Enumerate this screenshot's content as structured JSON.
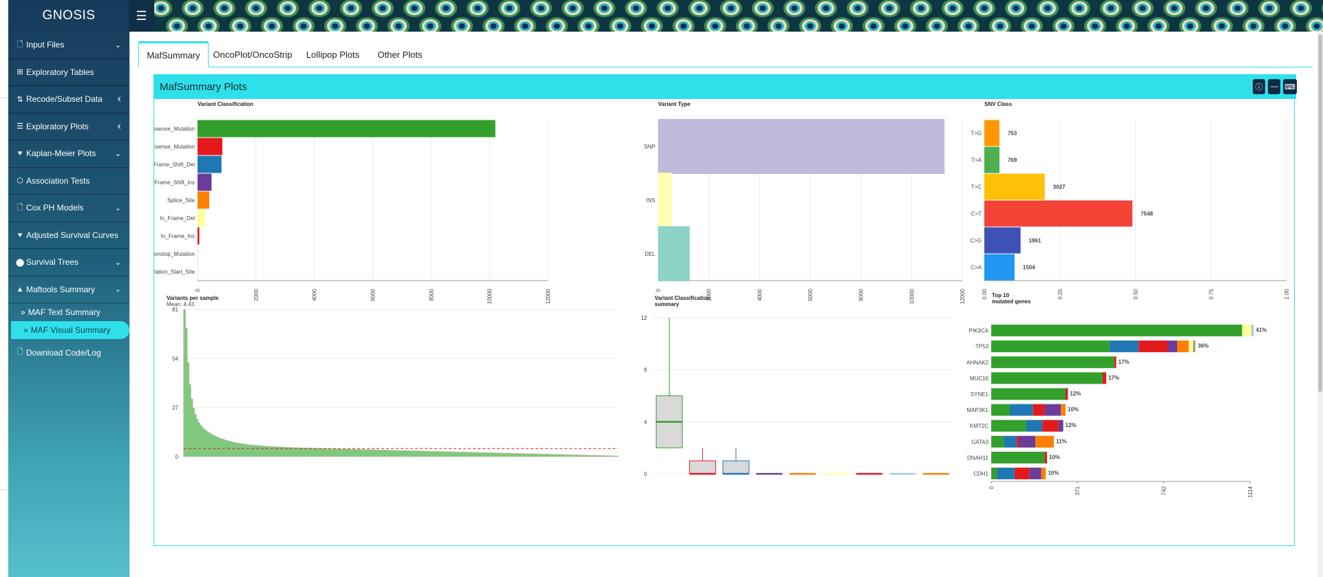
{
  "app": {
    "title": "GNOSIS"
  },
  "sidebar": {
    "items": [
      {
        "label": "Input Files",
        "icon": "file-icon",
        "chevron": "down"
      },
      {
        "label": "Exploratory Tables",
        "icon": "table-icon",
        "chevron": ""
      },
      {
        "label": "Recode/Subset Data",
        "icon": "sort-icon",
        "chevron": "left"
      },
      {
        "label": "Exploratory Plots",
        "icon": "chart-icon",
        "chevron": "left"
      },
      {
        "label": "Kaplan-Meier Plots",
        "icon": "heartbeat-icon",
        "chevron": "down"
      },
      {
        "label": "Association Tests",
        "icon": "connect-icon",
        "chevron": ""
      },
      {
        "label": "Cox PH Models",
        "icon": "file-icon",
        "chevron": "down"
      },
      {
        "label": "Adjusted Survival Curves",
        "icon": "heartbeat-icon",
        "chevron": ""
      },
      {
        "label": "Survival Trees",
        "icon": "tree-icon",
        "chevron": "down"
      },
      {
        "label": "Maftools Summary",
        "icon": "warning-icon",
        "chevron": "down"
      }
    ],
    "subitems": [
      {
        "label": "MAF Text Summary",
        "active": false
      },
      {
        "label": "MAF Visual Summary",
        "active": true
      }
    ],
    "download_label": "Download Code/Log"
  },
  "tabs": [
    {
      "label": "MafSummary",
      "active": true
    },
    {
      "label": "OncoPlot/OncoStrip",
      "active": false
    },
    {
      "label": "Lollipop Plots",
      "active": false
    },
    {
      "label": "Other Plots",
      "active": false
    }
  ],
  "box": {
    "title": "MafSummary Plots"
  },
  "colors": {
    "accent": "#2ee0ea",
    "sidebar_dark": "#173a5a"
  },
  "chart_data": [
    {
      "type": "bar",
      "title": "Variant Classification",
      "orientation": "horizontal",
      "categories": [
        "Missense_Mutation",
        "Nonsense_Mutation",
        "Frame_Shift_Del",
        "Frame_Shift_Ins",
        "Splice_Site",
        "In_Frame_Del",
        "In_Frame_Ins",
        "Nonstop_Mutation",
        "Translation_Start_Site"
      ],
      "values": [
        10200,
        850,
        820,
        480,
        400,
        250,
        60,
        8,
        5
      ],
      "colors": [
        "#33a02c",
        "#e31a1c",
        "#1f78b4",
        "#6a3d9a",
        "#ff7f00",
        "#ffff99",
        "#e31a1c",
        "#cccccc",
        "#cccccc"
      ],
      "xlim": [
        0,
        12000
      ],
      "xticks": [
        "0",
        "2000",
        "4000",
        "6000",
        "8000",
        "10000",
        "12000"
      ]
    },
    {
      "type": "bar",
      "title": "Variant Type",
      "orientation": "horizontal",
      "categories": [
        "SNP",
        "INS",
        "DEL"
      ],
      "values": [
        11300,
        550,
        1250
      ],
      "colors": [
        "#bebada",
        "#ffffb3",
        "#8dd3c7"
      ],
      "xlim": [
        0,
        12000
      ],
      "xticks": [
        "0",
        "2000",
        "4000",
        "6000",
        "8000",
        "10000",
        "12000"
      ]
    },
    {
      "type": "bar",
      "title": "SNV Class",
      "orientation": "horizontal",
      "categories": [
        "T>G",
        "T>A",
        "T>C",
        "C>T",
        "C>G",
        "C>A"
      ],
      "values": [
        753,
        769,
        3027,
        7548,
        1861,
        1504
      ],
      "fractions": [
        0.05,
        0.05,
        0.2,
        0.49,
        0.12,
        0.1
      ],
      "colors": [
        "#ff9800",
        "#4caf50",
        "#ffc107",
        "#f44336",
        "#3f51b5",
        "#2196f3"
      ],
      "xlim": [
        0,
        1
      ],
      "xticks": [
        "0.00",
        "0.25",
        "0.50",
        "0.75",
        "1.00"
      ]
    },
    {
      "type": "bar",
      "title": "Variants per sample",
      "subtitle": "Mean: 4.43",
      "yticks": [
        "0",
        "27",
        "54",
        "81"
      ],
      "ylim": [
        0,
        81
      ],
      "mean": 4.43
    },
    {
      "type": "box",
      "title": "Variant Classification summary",
      "yticks": [
        "0",
        "4",
        "8",
        "12"
      ],
      "ylim": [
        0,
        12
      ],
      "boxes": [
        {
          "color": "#33a02c",
          "q1": 2,
          "median": 4,
          "q3": 6,
          "min": 0,
          "max": 12
        },
        {
          "color": "#e31a1c",
          "q1": 0,
          "median": 0,
          "q3": 1,
          "min": 0,
          "max": 2
        },
        {
          "color": "#1f78b4",
          "q1": 0,
          "median": 0,
          "q3": 1,
          "min": 0,
          "max": 2
        },
        {
          "color": "#6a3d9a",
          "q1": 0,
          "median": 0,
          "q3": 0,
          "min": 0,
          "max": 0
        },
        {
          "color": "#ff7f00",
          "q1": 0,
          "median": 0,
          "q3": 0,
          "min": 0,
          "max": 0
        },
        {
          "color": "#ffff99",
          "q1": 0,
          "median": 0,
          "q3": 0,
          "min": 0,
          "max": 0
        },
        {
          "color": "#e31a1c",
          "q1": 0,
          "median": 0,
          "q3": 0,
          "min": 0,
          "max": 0
        },
        {
          "color": "#a6cee3",
          "q1": 0,
          "median": 0,
          "q3": 0,
          "min": 0,
          "max": 0
        },
        {
          "color": "#ff7f00",
          "q1": 0,
          "median": 0,
          "q3": 0,
          "min": 0,
          "max": 0
        }
      ]
    },
    {
      "type": "bar",
      "title": "Top 10\nmutated genes",
      "orientation": "horizontal",
      "stacked": true,
      "categories": [
        "PIK3CA",
        "TP53",
        "AHNAK2",
        "MUC16",
        "SYNE1",
        "MAP3K1",
        "KMT2C",
        "GATA3",
        "DNAH11",
        "CDH1"
      ],
      "percent_labels": [
        "41%",
        "36%",
        "17%",
        "17%",
        "12%",
        "10%",
        "12%",
        "11%",
        "10%",
        "10%"
      ],
      "xticks": [
        "0",
        "371",
        "742",
        "1114"
      ],
      "xlim": [
        0,
        1114
      ],
      "segment_colors": [
        "#33a02c",
        "#1f78b4",
        "#e31a1c",
        "#6a3d9a",
        "#ff7f00",
        "#ffff99",
        "#b15928",
        "#a6cee3"
      ],
      "segments": [
        [
          1080,
          0,
          0,
          0,
          0,
          40,
          0,
          10
        ],
        [
          510,
          125,
          125,
          40,
          50,
          20,
          5,
          5
        ],
        [
          530,
          0,
          8,
          0,
          0,
          0,
          0,
          0
        ],
        [
          480,
          0,
          15,
          0,
          0,
          0,
          0,
          0
        ],
        [
          320,
          0,
          10,
          0,
          0,
          0,
          0,
          0
        ],
        [
          80,
          100,
          50,
          70,
          20,
          0,
          0,
          0
        ],
        [
          150,
          70,
          70,
          20,
          0,
          0,
          0,
          0
        ],
        [
          55,
          55,
          10,
          70,
          80,
          0,
          0,
          0
        ],
        [
          230,
          0,
          10,
          0,
          0,
          0,
          0,
          0
        ],
        [
          25,
          75,
          65,
          50,
          20,
          0,
          0,
          0
        ]
      ]
    }
  ]
}
